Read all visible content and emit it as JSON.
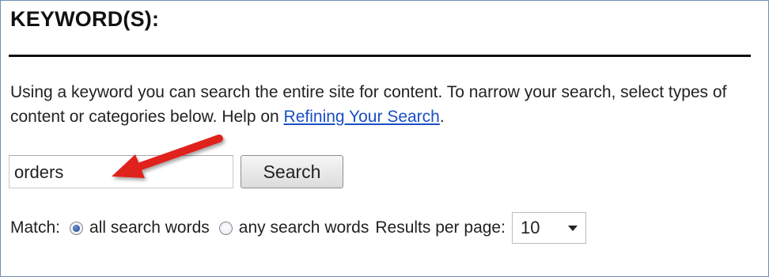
{
  "section": {
    "heading": "KEYWORD(S):"
  },
  "description": {
    "text": "Using a keyword you can search the entire site for content. To narrow your search, select types of content or categories below. Help on ",
    "link_text": "Refining Your Search",
    "trailing": "."
  },
  "search": {
    "value": "orders",
    "button_label": "Search"
  },
  "match": {
    "label": "Match:",
    "options": [
      {
        "label": "all search words",
        "checked": true
      },
      {
        "label": "any search words",
        "checked": false
      }
    ]
  },
  "results_per_page": {
    "label": "Results per page:",
    "selected": "10"
  },
  "annotation": {
    "icon": "red-arrow-icon",
    "color": "#e0201b"
  },
  "colors": {
    "frame_border": "#6f8fb8",
    "link": "#1a4fc4"
  }
}
